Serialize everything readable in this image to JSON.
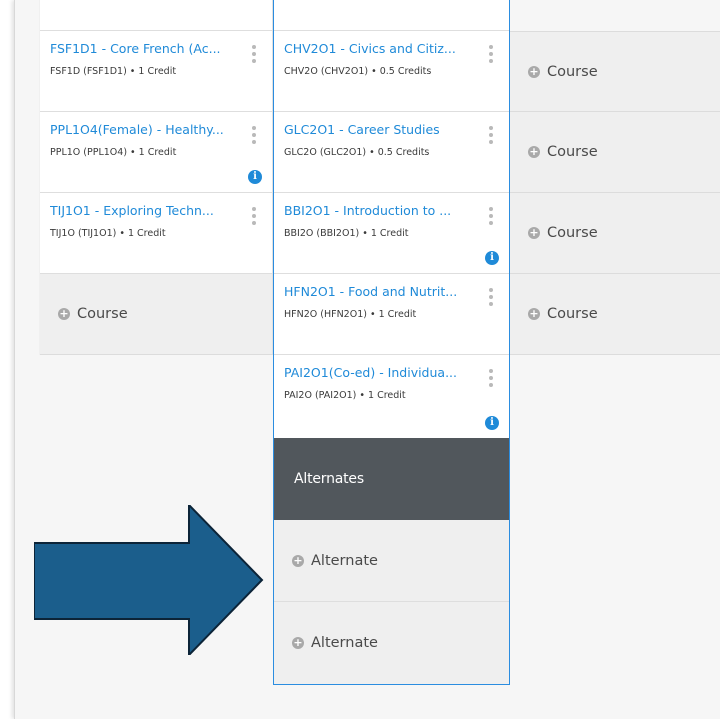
{
  "col1": [
    {
      "title": "FSF1D1 - Core French (Ac...",
      "meta": "FSF1D (FSF1D1) • 1 Credit",
      "info": false
    },
    {
      "title": "PPL1O4(Female) - Healthy...",
      "meta": "PPL1O (PPL1O4) • 1 Credit",
      "info": true
    },
    {
      "title": "TIJ1O1 - Exploring Techn...",
      "meta": "TIJ1O (TIJ1O1) • 1 Credit",
      "info": false
    }
  ],
  "col2": [
    {
      "title": "CHV2O1 - Civics and Citiz...",
      "meta": "CHV2O (CHV2O1) • 0.5 Credits",
      "info": false
    },
    {
      "title": "GLC2O1 - Career Studies",
      "meta": "GLC2O (GLC2O1) • 0.5 Credits",
      "info": false
    },
    {
      "title": "BBI2O1 - Introduction to ...",
      "meta": "BBI2O (BBI2O1) • 1 Credit",
      "info": true
    },
    {
      "title": "HFN2O1 - Food and Nutrit...",
      "meta": "HFN2O (HFN2O1) • 1 Credit",
      "info": false
    },
    {
      "title": "PAI2O1(Co-ed) - Individua...",
      "meta": "PAI2O (PAI2O1) • 1 Credit",
      "info": true
    }
  ],
  "add_course_label": "Course",
  "alternates": {
    "header": "Alternates",
    "add_label": "Alternate"
  },
  "colors": {
    "link": "#1f8ad8",
    "selected_border": "#2b8de0",
    "header_bg": "#51575c",
    "arrow": "#1b5e8c"
  }
}
